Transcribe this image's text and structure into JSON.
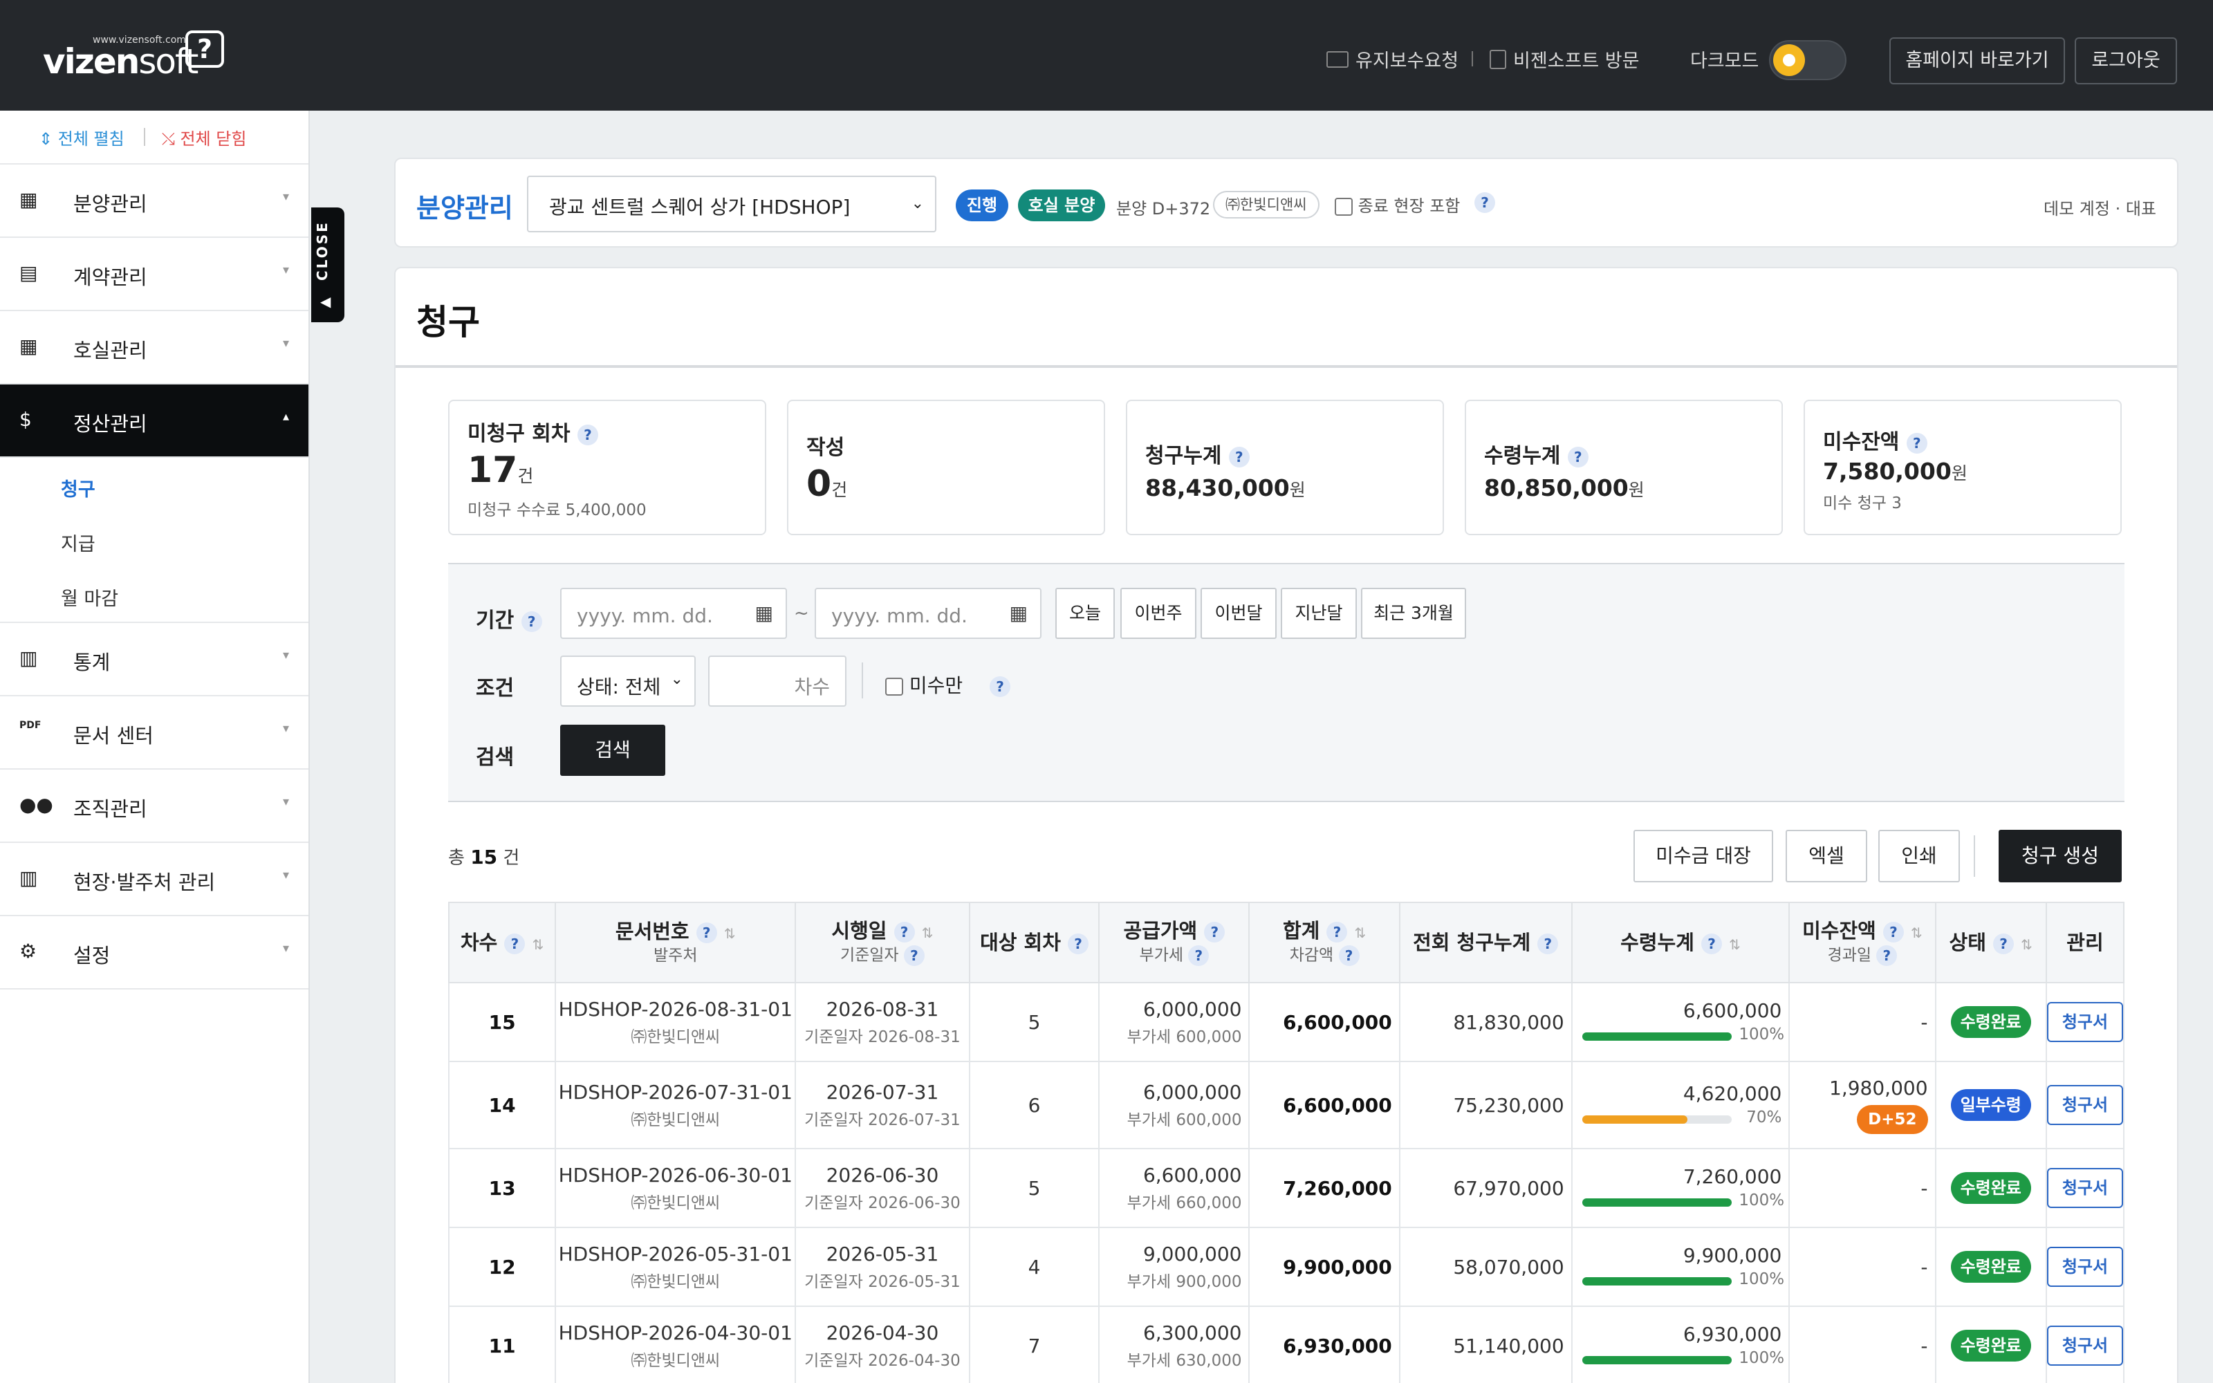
{
  "topbar": {
    "logo_small": "www.vizensoft.com",
    "logo_main": "vizen",
    "logo_soft": "soft",
    "logo_q": "?",
    "link_maint": "유지보수요청",
    "link_visit": "비젠소프트 방문",
    "darkmode_label": "다크모드",
    "darkmode_on": false,
    "btn_home": "홈페이지 바로가기",
    "btn_logout": "로그아웃"
  },
  "sidebar": {
    "expand_all": "⇕ 전체 펼침",
    "collapse_all": "⤯ 전체 닫힘",
    "close_tab": "CLOSE",
    "items": [
      {
        "label": "분양관리",
        "icon": "building-icon"
      },
      {
        "label": "계약관리",
        "icon": "document-icon"
      },
      {
        "label": "호실관리",
        "icon": "grid-icon"
      },
      {
        "label": "정산관리",
        "icon": "dollar-icon",
        "active": true
      },
      {
        "label": "통계",
        "icon": "bar-chart-icon"
      },
      {
        "label": "문서 센터",
        "icon": "pdf-icon"
      },
      {
        "label": "조직관리",
        "icon": "users-icon"
      },
      {
        "label": "현장·발주처 관리",
        "icon": "bank-icon"
      },
      {
        "label": "설정",
        "icon": "gear-icon"
      }
    ],
    "subitems": [
      "청구",
      "지급",
      "월 마감"
    ]
  },
  "header": {
    "title": "분양관리",
    "site_select": "광교 센트럴 스퀘어 상가 [HDSHOP]",
    "pill_status": "진행",
    "pill_type": "호실 분양",
    "dday": "분양 D+372",
    "company": "㈜한빛디앤씨",
    "include_closed": "종료 현장 포함",
    "account": "데모 계정 · 대표"
  },
  "page": {
    "title": "청구"
  },
  "cards": {
    "unbilled": {
      "label": "미청구 회차",
      "value": "17",
      "unit": "건",
      "sub": "미청구 수수료 5,400,000"
    },
    "draft": {
      "label": "작성",
      "value": "0",
      "unit": "건"
    },
    "billed": {
      "label": "청구누계",
      "value": "88,430,000",
      "unit": "원"
    },
    "received": {
      "label": "수령누계",
      "value": "80,850,000",
      "unit": "원"
    },
    "outstanding": {
      "label": "미수잔액",
      "value": "7,580,000",
      "unit": "원",
      "sub": "미수 청구 3"
    }
  },
  "filters": {
    "period_label": "기간",
    "date_placeholder": "yyyy. mm. dd.",
    "tilde": "~",
    "quick": [
      "오늘",
      "이번주",
      "이번달",
      "지난달",
      "최근 3개월"
    ],
    "cond_label": "조건",
    "status_select": "상태: 전체",
    "round_placeholder": "차수",
    "unpaid_only": "미수만",
    "search_label": "검색",
    "search_btn": "검색"
  },
  "list": {
    "total_prefix": "총",
    "total_count": "15",
    "total_suffix": "건",
    "btn_ledger": "미수금 대장",
    "btn_excel": "엑셀",
    "btn_print": "인쇄",
    "btn_create": "청구 생성"
  },
  "table": {
    "headers": {
      "round": "차수",
      "docno": "문서번호",
      "docno_sub": "발주처",
      "date": "시행일",
      "date_sub": "기준일자",
      "target": "대상 회차",
      "supply": "공급가액",
      "supply_sub": "부가세",
      "sum": "합계",
      "sum_sub": "차감액",
      "prev": "전회 청구누계",
      "recv": "수령누계",
      "out": "미수잔액",
      "out_sub": "경과일",
      "status": "상태",
      "manage": "관리"
    },
    "rows": [
      {
        "round": "15",
        "docno": "HDSHOP-2026-08-31-01",
        "client": "㈜한빛디앤씨",
        "date": "2026-08-31",
        "base": "기준일자 2026-08-31",
        "target": "5",
        "supply": "6,000,000",
        "vat": "부가세 600,000",
        "sum": "6,600,000",
        "prev": "81,830,000",
        "recv": "6,600,000",
        "pct": "100%",
        "pct_value": 100,
        "out": "-",
        "days": "",
        "status": "수령완료",
        "status_color": "#1e9a45",
        "bar_color": "#1e9a45",
        "manage": "청구서"
      },
      {
        "round": "14",
        "docno": "HDSHOP-2026-07-31-01",
        "client": "㈜한빛디앤씨",
        "date": "2026-07-31",
        "base": "기준일자 2026-07-31",
        "target": "6",
        "supply": "6,000,000",
        "vat": "부가세 600,000",
        "sum": "6,600,000",
        "prev": "75,230,000",
        "recv": "4,620,000",
        "pct": "70%",
        "pct_value": 70,
        "out": "1,980,000",
        "days": "D+52",
        "status": "일부수령",
        "status_color": "#2560d8",
        "bar_color": "#f0a020",
        "manage": "청구서"
      },
      {
        "round": "13",
        "docno": "HDSHOP-2026-06-30-01",
        "client": "㈜한빛디앤씨",
        "date": "2026-06-30",
        "base": "기준일자 2026-06-30",
        "target": "5",
        "supply": "6,600,000",
        "vat": "부가세 660,000",
        "sum": "7,260,000",
        "prev": "67,970,000",
        "recv": "7,260,000",
        "pct": "100%",
        "pct_value": 100,
        "out": "-",
        "days": "",
        "status": "수령완료",
        "status_color": "#1e9a45",
        "bar_color": "#1e9a45",
        "manage": "청구서"
      },
      {
        "round": "12",
        "docno": "HDSHOP-2026-05-31-01",
        "client": "㈜한빛디앤씨",
        "date": "2026-05-31",
        "base": "기준일자 2026-05-31",
        "target": "4",
        "supply": "9,000,000",
        "vat": "부가세 900,000",
        "sum": "9,900,000",
        "prev": "58,070,000",
        "recv": "9,900,000",
        "pct": "100%",
        "pct_value": 100,
        "out": "-",
        "days": "",
        "status": "수령완료",
        "status_color": "#1e9a45",
        "bar_color": "#1e9a45",
        "manage": "청구서"
      },
      {
        "round": "11",
        "docno": "HDSHOP-2026-04-30-01",
        "client": "㈜한빛디앤씨",
        "date": "2026-04-30",
        "base": "기준일자 2026-04-30",
        "target": "7",
        "supply": "6,300,000",
        "vat": "부가세 630,000",
        "sum": "6,930,000",
        "prev": "51,140,000",
        "recv": "6,930,000",
        "pct": "100%",
        "pct_value": 100,
        "out": "-",
        "days": "",
        "status": "수령완료",
        "status_color": "#1e9a45",
        "bar_color": "#1e9a45",
        "manage": "청구서"
      }
    ]
  }
}
